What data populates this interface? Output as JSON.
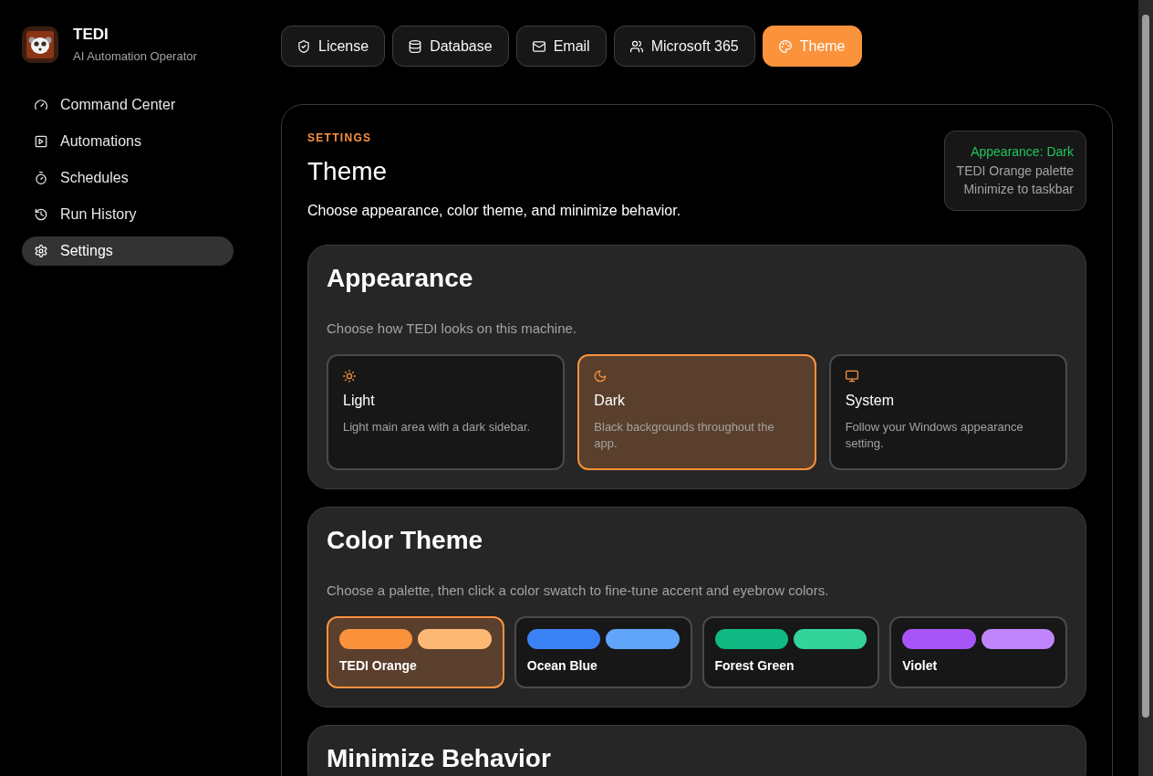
{
  "app": {
    "name": "TEDI",
    "subtitle": "AI Automation Operator"
  },
  "sidebar": {
    "items": [
      {
        "label": "Command Center",
        "selected": false
      },
      {
        "label": "Automations",
        "selected": false
      },
      {
        "label": "Schedules",
        "selected": false
      },
      {
        "label": "Run History",
        "selected": false
      },
      {
        "label": "Settings",
        "selected": true
      }
    ]
  },
  "tabs": [
    {
      "label": "License",
      "selected": false
    },
    {
      "label": "Database",
      "selected": false
    },
    {
      "label": "Email",
      "selected": false
    },
    {
      "label": "Microsoft 365",
      "selected": false
    },
    {
      "label": "Theme",
      "selected": true
    }
  ],
  "settings_panel": {
    "eyebrow": "SETTINGS",
    "title": "Theme",
    "description": "Choose appearance, color theme, and minimize behavior.",
    "summary": [
      {
        "text": "Appearance: Dark",
        "highlighted": true
      },
      {
        "text": "TEDI Orange palette",
        "highlighted": false
      },
      {
        "text": "Minimize to taskbar",
        "highlighted": false
      }
    ],
    "sections": [
      {
        "title": "Appearance",
        "description": "Choose how TEDI looks on this machine.",
        "options": [
          {
            "label": "Light",
            "description": "Light main area with a dark sidebar.",
            "selected": false
          },
          {
            "label": "Dark",
            "description": "Black backgrounds throughout the app.",
            "selected": true
          },
          {
            "label": "System",
            "description": "Follow your Windows appearance setting.",
            "selected": false
          }
        ]
      },
      {
        "title": "Color Theme",
        "description": "Choose a palette, then click a color swatch to fine-tune accent and eyebrow colors.",
        "palettes": [
          {
            "name": "TEDI Orange",
            "selected": true,
            "swatches": [
              {
                "color": "#fb923c"
              },
              {
                "color": "#fdba74"
              }
            ]
          },
          {
            "name": "Ocean Blue",
            "selected": false,
            "swatches": [
              {
                "color": "#3b82f6"
              },
              {
                "color": "#60a5fa"
              }
            ]
          },
          {
            "name": "Forest Green",
            "selected": false,
            "swatches": [
              {
                "color": "#10b981"
              },
              {
                "color": "#34d399"
              }
            ]
          },
          {
            "name": "Violet",
            "selected": false,
            "swatches": [
              {
                "color": "#a855f7"
              },
              {
                "color": "#c084fc"
              }
            ]
          }
        ]
      },
      {
        "title": "Minimize Behavior"
      }
    ]
  }
}
